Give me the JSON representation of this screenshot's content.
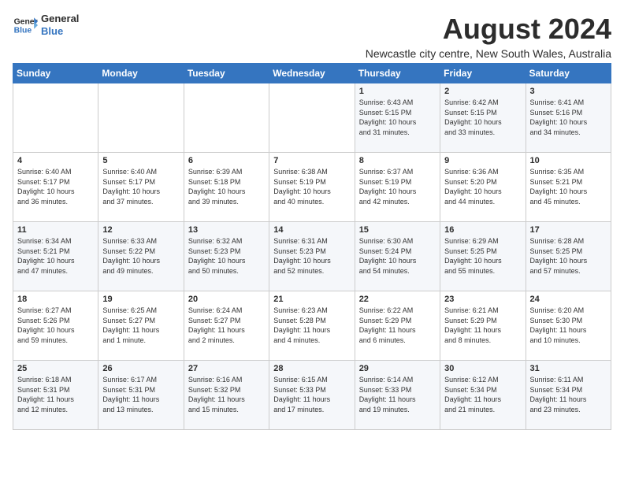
{
  "logo": {
    "line1": "General",
    "line2": "Blue"
  },
  "title": "August 2024",
  "location": "Newcastle city centre, New South Wales, Australia",
  "days_of_week": [
    "Sunday",
    "Monday",
    "Tuesday",
    "Wednesday",
    "Thursday",
    "Friday",
    "Saturday"
  ],
  "weeks": [
    [
      {
        "day": "",
        "info": ""
      },
      {
        "day": "",
        "info": ""
      },
      {
        "day": "",
        "info": ""
      },
      {
        "day": "",
        "info": ""
      },
      {
        "day": "1",
        "info": "Sunrise: 6:43 AM\nSunset: 5:15 PM\nDaylight: 10 hours\nand 31 minutes."
      },
      {
        "day": "2",
        "info": "Sunrise: 6:42 AM\nSunset: 5:15 PM\nDaylight: 10 hours\nand 33 minutes."
      },
      {
        "day": "3",
        "info": "Sunrise: 6:41 AM\nSunset: 5:16 PM\nDaylight: 10 hours\nand 34 minutes."
      }
    ],
    [
      {
        "day": "4",
        "info": "Sunrise: 6:40 AM\nSunset: 5:17 PM\nDaylight: 10 hours\nand 36 minutes."
      },
      {
        "day": "5",
        "info": "Sunrise: 6:40 AM\nSunset: 5:17 PM\nDaylight: 10 hours\nand 37 minutes."
      },
      {
        "day": "6",
        "info": "Sunrise: 6:39 AM\nSunset: 5:18 PM\nDaylight: 10 hours\nand 39 minutes."
      },
      {
        "day": "7",
        "info": "Sunrise: 6:38 AM\nSunset: 5:19 PM\nDaylight: 10 hours\nand 40 minutes."
      },
      {
        "day": "8",
        "info": "Sunrise: 6:37 AM\nSunset: 5:19 PM\nDaylight: 10 hours\nand 42 minutes."
      },
      {
        "day": "9",
        "info": "Sunrise: 6:36 AM\nSunset: 5:20 PM\nDaylight: 10 hours\nand 44 minutes."
      },
      {
        "day": "10",
        "info": "Sunrise: 6:35 AM\nSunset: 5:21 PM\nDaylight: 10 hours\nand 45 minutes."
      }
    ],
    [
      {
        "day": "11",
        "info": "Sunrise: 6:34 AM\nSunset: 5:21 PM\nDaylight: 10 hours\nand 47 minutes."
      },
      {
        "day": "12",
        "info": "Sunrise: 6:33 AM\nSunset: 5:22 PM\nDaylight: 10 hours\nand 49 minutes."
      },
      {
        "day": "13",
        "info": "Sunrise: 6:32 AM\nSunset: 5:23 PM\nDaylight: 10 hours\nand 50 minutes."
      },
      {
        "day": "14",
        "info": "Sunrise: 6:31 AM\nSunset: 5:23 PM\nDaylight: 10 hours\nand 52 minutes."
      },
      {
        "day": "15",
        "info": "Sunrise: 6:30 AM\nSunset: 5:24 PM\nDaylight: 10 hours\nand 54 minutes."
      },
      {
        "day": "16",
        "info": "Sunrise: 6:29 AM\nSunset: 5:25 PM\nDaylight: 10 hours\nand 55 minutes."
      },
      {
        "day": "17",
        "info": "Sunrise: 6:28 AM\nSunset: 5:25 PM\nDaylight: 10 hours\nand 57 minutes."
      }
    ],
    [
      {
        "day": "18",
        "info": "Sunrise: 6:27 AM\nSunset: 5:26 PM\nDaylight: 10 hours\nand 59 minutes."
      },
      {
        "day": "19",
        "info": "Sunrise: 6:25 AM\nSunset: 5:27 PM\nDaylight: 11 hours\nand 1 minute."
      },
      {
        "day": "20",
        "info": "Sunrise: 6:24 AM\nSunset: 5:27 PM\nDaylight: 11 hours\nand 2 minutes."
      },
      {
        "day": "21",
        "info": "Sunrise: 6:23 AM\nSunset: 5:28 PM\nDaylight: 11 hours\nand 4 minutes."
      },
      {
        "day": "22",
        "info": "Sunrise: 6:22 AM\nSunset: 5:29 PM\nDaylight: 11 hours\nand 6 minutes."
      },
      {
        "day": "23",
        "info": "Sunrise: 6:21 AM\nSunset: 5:29 PM\nDaylight: 11 hours\nand 8 minutes."
      },
      {
        "day": "24",
        "info": "Sunrise: 6:20 AM\nSunset: 5:30 PM\nDaylight: 11 hours\nand 10 minutes."
      }
    ],
    [
      {
        "day": "25",
        "info": "Sunrise: 6:18 AM\nSunset: 5:31 PM\nDaylight: 11 hours\nand 12 minutes."
      },
      {
        "day": "26",
        "info": "Sunrise: 6:17 AM\nSunset: 5:31 PM\nDaylight: 11 hours\nand 13 minutes."
      },
      {
        "day": "27",
        "info": "Sunrise: 6:16 AM\nSunset: 5:32 PM\nDaylight: 11 hours\nand 15 minutes."
      },
      {
        "day": "28",
        "info": "Sunrise: 6:15 AM\nSunset: 5:33 PM\nDaylight: 11 hours\nand 17 minutes."
      },
      {
        "day": "29",
        "info": "Sunrise: 6:14 AM\nSunset: 5:33 PM\nDaylight: 11 hours\nand 19 minutes."
      },
      {
        "day": "30",
        "info": "Sunrise: 6:12 AM\nSunset: 5:34 PM\nDaylight: 11 hours\nand 21 minutes."
      },
      {
        "day": "31",
        "info": "Sunrise: 6:11 AM\nSunset: 5:34 PM\nDaylight: 11 hours\nand 23 minutes."
      }
    ]
  ]
}
